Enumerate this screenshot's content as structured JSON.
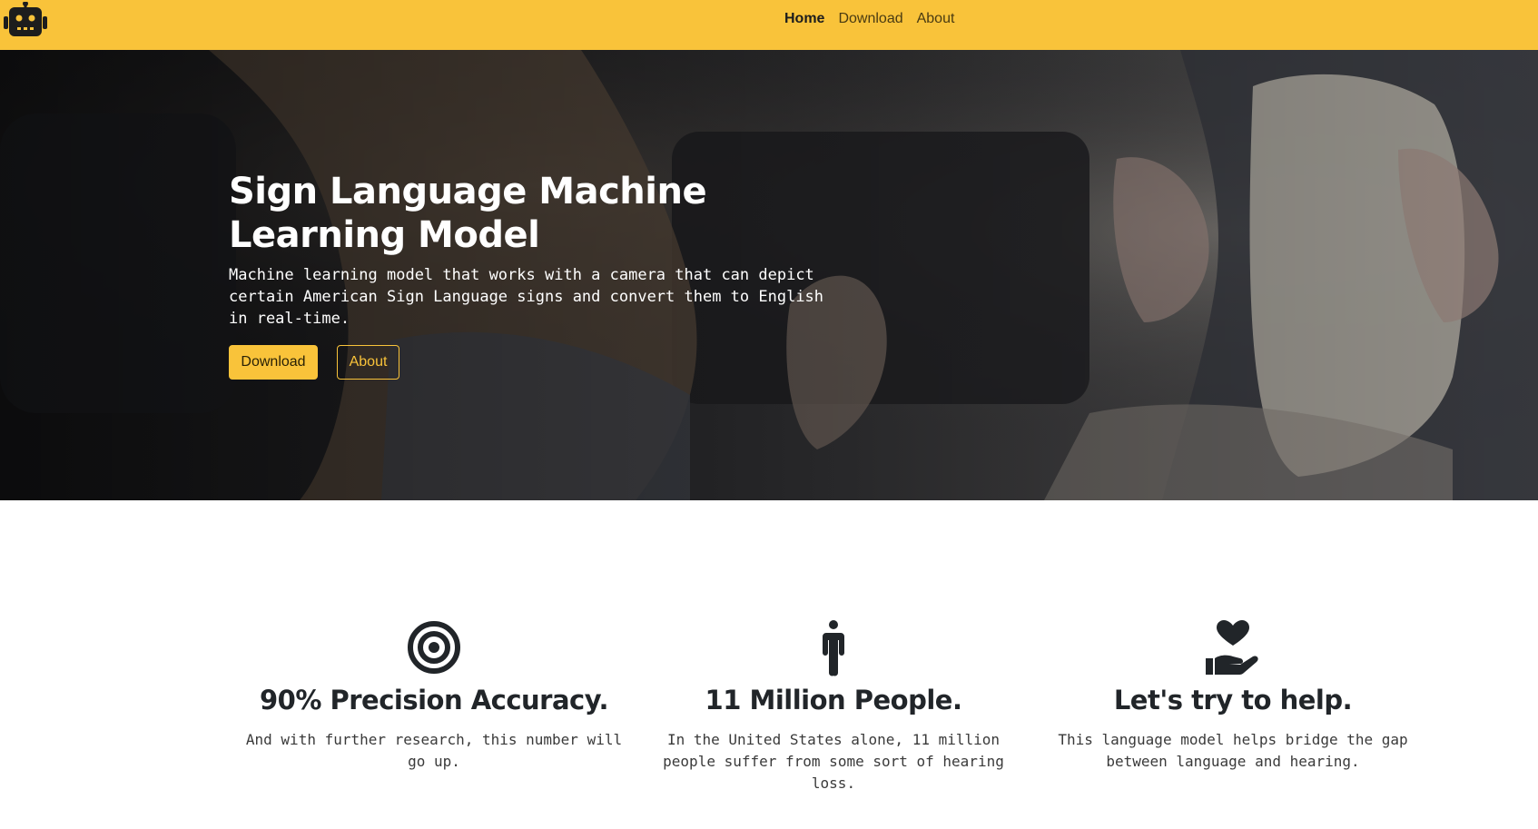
{
  "nav": {
    "links": [
      {
        "label": "Home",
        "active": true
      },
      {
        "label": "Download",
        "active": false
      },
      {
        "label": "About",
        "active": false
      }
    ]
  },
  "hero": {
    "title": "Sign Language Machine Learning Model",
    "description": "Machine learning model that works with a camera that can depict certain American Sign Language signs and convert them to English in real-time.",
    "download_label": "Download",
    "about_label": "About"
  },
  "features": [
    {
      "icon": "target-icon",
      "title": "90% Precision Accuracy.",
      "text": "And with further research, this number will go up."
    },
    {
      "icon": "person-icon",
      "title": "11 Million People.",
      "text": "In the United States alone, 11 million people suffer from some sort of hearing loss."
    },
    {
      "icon": "hand-heart-icon",
      "title": "Let's try to help.",
      "text": "This language model helps bridge the gap between language and hearing."
    }
  ],
  "colors": {
    "accent": "#f9c33a",
    "dark_text": "#212529"
  }
}
